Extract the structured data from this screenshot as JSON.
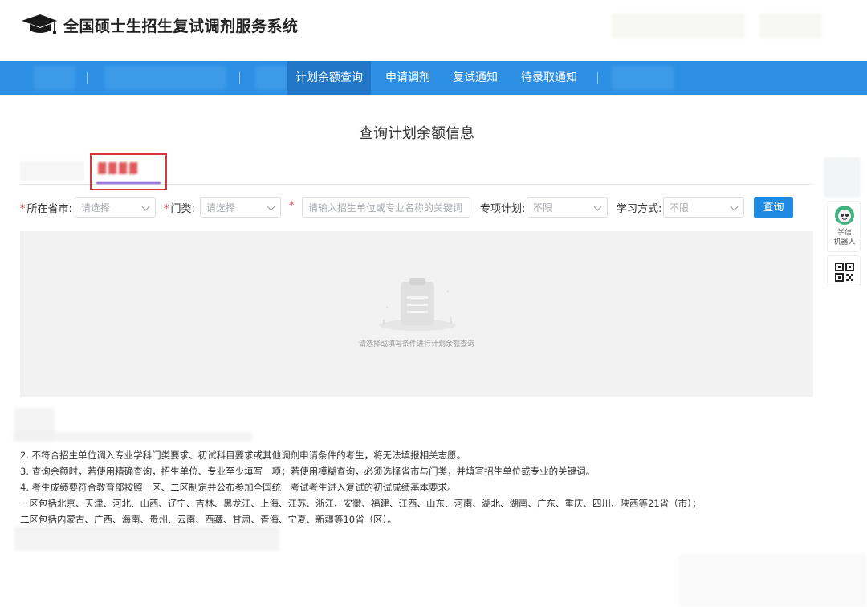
{
  "header": {
    "title": "全国硕士生招生复试调剂服务系统"
  },
  "nav": {
    "items": [
      "计划余额查询",
      "申请调剂",
      "复试通知",
      "待录取通知"
    ]
  },
  "page": {
    "title": "查询计划余额信息"
  },
  "filters": {
    "province_label": "所在省市:",
    "province_placeholder": "请选择",
    "category_label": "门类:",
    "category_placeholder": "请选择",
    "keyword_placeholder": "请输入招生单位或专业名称的关键词",
    "special_label": "专项计划:",
    "special_value": "不限",
    "study_label": "学习方式:",
    "study_value": "不限",
    "query_button": "查询"
  },
  "result": {
    "empty_text": "请选择或填写条件进行计划余额查询"
  },
  "notes": [
    "2. 不符合招生单位调入专业学科门类要求、初试科目要求或其他调剂申请条件的考生，将无法填报相关志愿。",
    "3. 查询余额时，若使用精确查询，招生单位、专业至少填写一项；若使用模糊查询，必须选择省市与门类，并填写招生单位或专业的关键词。",
    "4. 考生成绩要符合教育部按照一区、二区制定并公布参加全国统一考试考生进入复试的初试成绩基本要求。",
    "一区包括北京、天津、河北、山西、辽宁、吉林、黑龙江、上海、江苏、浙江、安徽、福建、江西、山东、河南、湖北、湖南、广东、重庆、四川、陕西等21省（市）；",
    "二区包括内蒙古、广西、海南、贵州、云南、西藏、甘肃、青海、宁夏、新疆等10省（区）。"
  ],
  "sidebar": {
    "robot_label_1": "学信",
    "robot_label_2": "机器人"
  },
  "colors": {
    "nav_bg": "#2d8fe4",
    "nav_active": "#2276c8",
    "primary_button": "#1f8ae0",
    "required_mark": "#e64242",
    "highlight_border": "#d9373a"
  }
}
